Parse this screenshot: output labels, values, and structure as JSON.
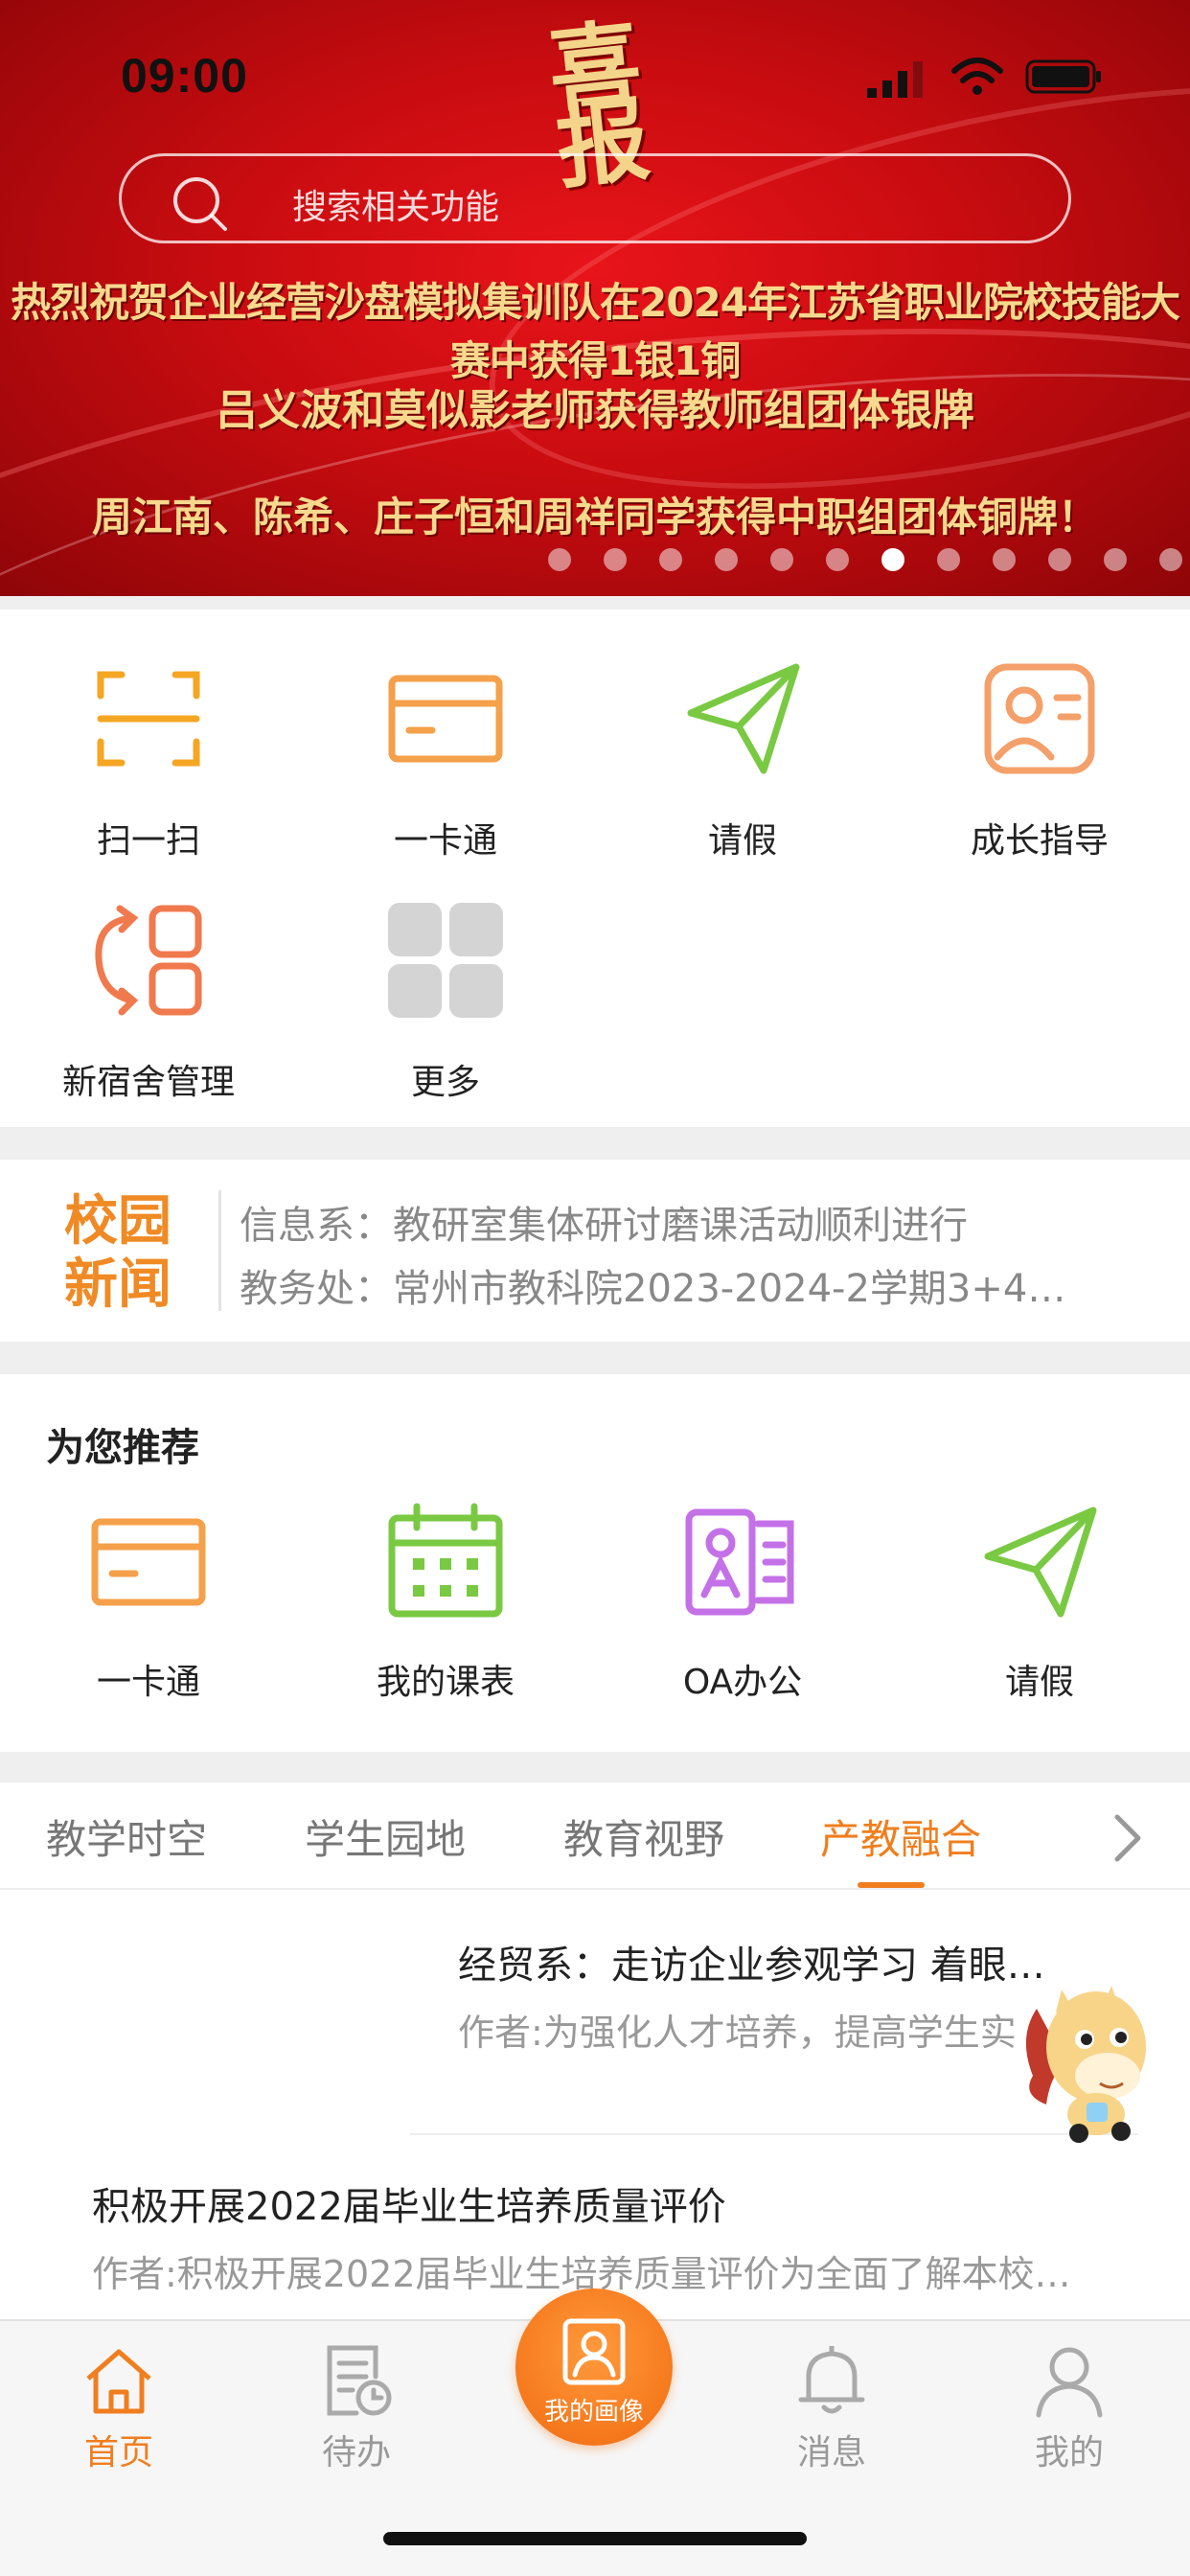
{
  "status_bar": {
    "time": "09:00"
  },
  "banner": {
    "logo_text": "喜报",
    "search_placeholder": "搜索相关功能",
    "headline_1": "热烈祝贺企业经营沙盘模拟集训队在2024年江苏省职业院校技能大赛中获得1银1铜",
    "headline_2": "吕义波和莫似影老师获得教师组团体银牌",
    "headline_3": "周江南、陈希、庄子恒和周祥同学获得中职组团体铜牌！",
    "carousel_total": 12,
    "carousel_active_index": 6
  },
  "quick_actions": [
    {
      "label": "扫一扫",
      "icon": "scan-icon",
      "color": "#f5a623"
    },
    {
      "label": "一卡通",
      "icon": "card-icon",
      "color": "#f5a04a"
    },
    {
      "label": "请假",
      "icon": "paper-plane-icon",
      "color": "#7ac943"
    },
    {
      "label": "成长指导",
      "icon": "growth-guide-icon",
      "color": "#f4a06a"
    },
    {
      "label": "新宿舍管理",
      "icon": "dorm-icon",
      "color": "#f07a4e"
    },
    {
      "label": "更多",
      "icon": "more-grid-icon",
      "color": "#d4d4d4"
    }
  ],
  "news": {
    "badge_line1": "校园",
    "badge_line2": "新闻",
    "items": [
      "信息系：教研室集体研讨磨课活动顺利进行",
      "教务处：常州市教科院2023-2024-2学期3+4…"
    ],
    "badge_color": "#f08a24"
  },
  "recommend": {
    "title": "为您推荐",
    "items": [
      {
        "label": "一卡通",
        "icon": "card-icon",
        "color": "#f5a04a"
      },
      {
        "label": "我的课表",
        "icon": "calendar-icon",
        "color": "#7ac943"
      },
      {
        "label": "OA办公",
        "icon": "oa-icon",
        "color": "#c471e8"
      },
      {
        "label": "请假",
        "icon": "paper-plane-icon",
        "color": "#7ac943"
      }
    ]
  },
  "content_tabs": {
    "tabs": [
      "教学时空",
      "学生园地",
      "教育视野",
      "产教融合"
    ],
    "active_index": 3
  },
  "articles": [
    {
      "title": "经贸系：走访企业参观学习 着眼…",
      "author": "作者:为强化人才培养，提高学生实"
    },
    {
      "title": "积极开展2022届毕业生培养质量评价",
      "author": "作者:积极开展2022届毕业生培养质量评价为全面了解本校…"
    }
  ],
  "tabbar": {
    "items": [
      {
        "label": "首页",
        "icon": "home-icon"
      },
      {
        "label": "待办",
        "icon": "todo-icon"
      },
      {
        "label": "我的画像",
        "icon": "portrait-icon"
      },
      {
        "label": "消息",
        "icon": "bell-icon"
      },
      {
        "label": "我的",
        "icon": "user-icon"
      }
    ],
    "active_index": 0,
    "accent": "#f07e1e"
  }
}
